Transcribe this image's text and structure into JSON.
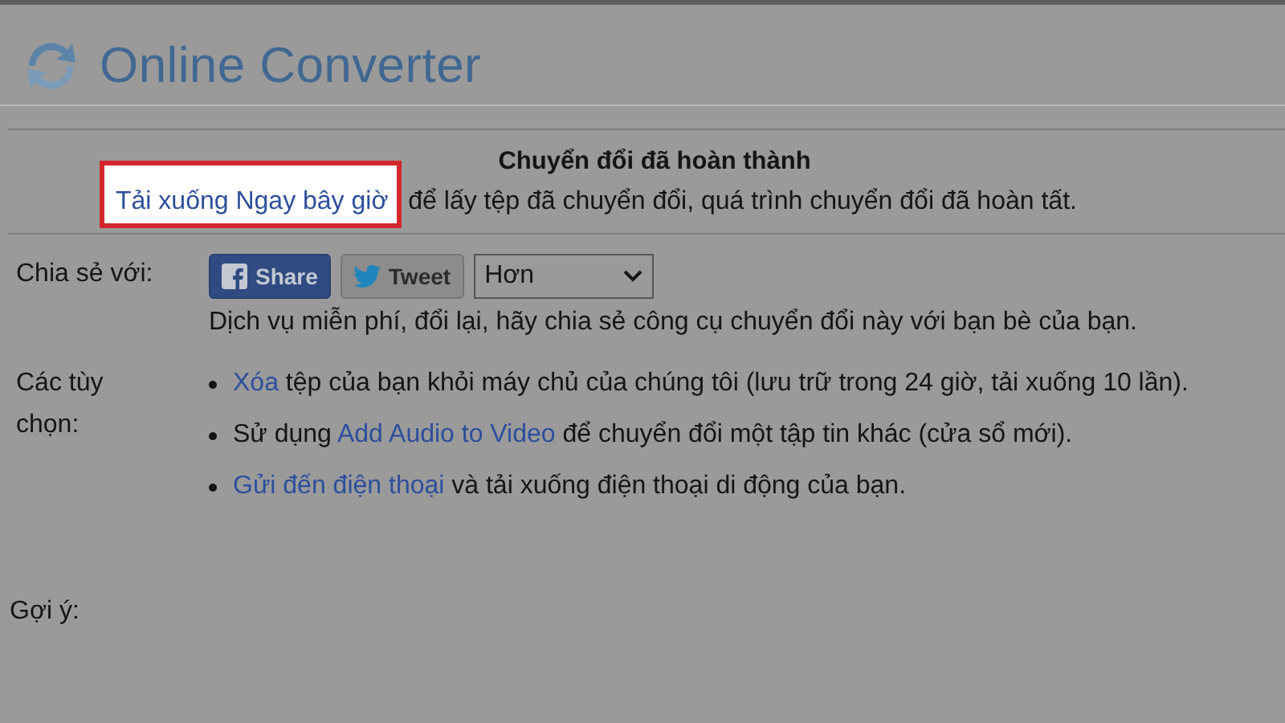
{
  "header": {
    "title": "Online Converter"
  },
  "result": {
    "heading": "Chuyển đổi đã hoàn thành",
    "download_link": "Tải xuống Ngay bây giờ",
    "highlighted": true,
    "message": "để lấy tệp đã chuyển đổi, quá trình chuyển đổi đã hoàn tất."
  },
  "share": {
    "label": "Chia sẻ với:",
    "buttons": [
      {
        "kind": "facebook",
        "label": "Share"
      },
      {
        "kind": "twitter",
        "label": "Tweet"
      }
    ],
    "more_select": {
      "value": "Hơn"
    },
    "note": "Dịch vụ miễn phí, đổi lại, hãy chia sẻ công cụ chuyển đổi này với bạn bè của bạn."
  },
  "options": {
    "label": "Các tùy chọn:",
    "items": [
      {
        "link": "Xóa",
        "after": " tệp của bạn khỏi máy chủ của chúng tôi (lưu trữ trong 24 giờ, tải xuống 10 lần)."
      },
      {
        "before": "Sử dụng ",
        "link": "Add Audio to Video",
        "after": " để chuyển đổi một tập tin khác (cửa sổ mới)."
      },
      {
        "link": "Gửi đến điện thoại",
        "after": " và tải xuống điện thoại di động của bạn."
      }
    ]
  },
  "hint": {
    "label": "Gợi ý:"
  }
}
